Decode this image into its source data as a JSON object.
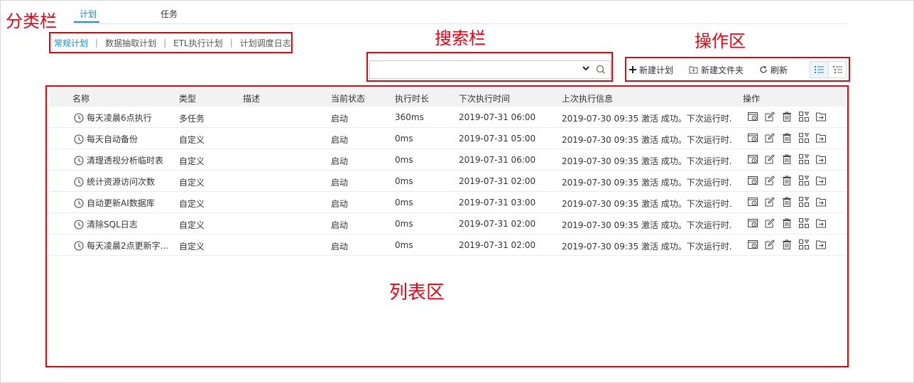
{
  "annotations": {
    "category_bar": "分类栏",
    "search_bar": "搜索栏",
    "action_area": "操作区",
    "list_area": "列表区",
    "color": "#e60012"
  },
  "top_tabs": [
    {
      "label": "计划",
      "active": true
    },
    {
      "label": "任务",
      "active": false
    }
  ],
  "categories": [
    {
      "label": "常规计划",
      "active": true
    },
    {
      "label": "数据抽取计划",
      "active": false
    },
    {
      "label": "ETL执行计划",
      "active": false
    },
    {
      "label": "计划调度日志",
      "active": false
    }
  ],
  "category_separator": "|",
  "search": {
    "placeholder": "",
    "value": ""
  },
  "toolbar": {
    "new_plan": "新建计划",
    "new_folder": "新建文件夹",
    "refresh": "刷新"
  },
  "table": {
    "columns": [
      "名称",
      "类型",
      "描述",
      "当前状态",
      "执行时长",
      "下次执行时间",
      "上次执行信息",
      "操作"
    ],
    "rows": [
      {
        "name": "每天凌晨6点执行",
        "type": "多任务",
        "desc": "",
        "status": "启动",
        "duration": "360ms",
        "next": "2019-07-31 06:00",
        "last": "2019-07-30 09:35 激活 成功。下次运行时..."
      },
      {
        "name": "每天自动备份",
        "type": "自定义",
        "desc": "",
        "status": "启动",
        "duration": "0ms",
        "next": "2019-07-31 05:00",
        "last": "2019-07-30 09:35 激活 成功。下次运行时..."
      },
      {
        "name": "清理透视分析临时表",
        "type": "自定义",
        "desc": "",
        "status": "启动",
        "duration": "0ms",
        "next": "2019-07-31 06:00",
        "last": "2019-07-30 09:35 激活 成功。下次运行时..."
      },
      {
        "name": "统计资源访问次数",
        "type": "自定义",
        "desc": "",
        "status": "启动",
        "duration": "0ms",
        "next": "2019-07-31 02:00",
        "last": "2019-07-30 09:35 激活 成功。下次运行时..."
      },
      {
        "name": "自动更新AI数据库",
        "type": "自定义",
        "desc": "",
        "status": "启动",
        "duration": "0ms",
        "next": "2019-07-31 03:00",
        "last": "2019-07-30 09:35 激活 成功。下次运行时..."
      },
      {
        "name": "清除SQL日志",
        "type": "自定义",
        "desc": "",
        "status": "启动",
        "duration": "0ms",
        "next": "2019-07-31 02:00",
        "last": "2019-07-30 09:35 激活 成功。下次运行时..."
      },
      {
        "name": "每天凌晨2点更新字...",
        "type": "自定义",
        "desc": "",
        "status": "启动",
        "duration": "0ms",
        "next": "2019-07-31 02:00",
        "last": "2019-07-30 09:35 激活 成功。下次运行时..."
      }
    ],
    "row_icon": "clock-icon",
    "operation_icons": [
      "run-history-icon",
      "edit-icon",
      "delete-icon",
      "permissions-icon",
      "move-icon"
    ]
  },
  "colors": {
    "accent": "#1e88c8",
    "annotation": "#e60012",
    "header_bg": "#f2f2f2"
  }
}
